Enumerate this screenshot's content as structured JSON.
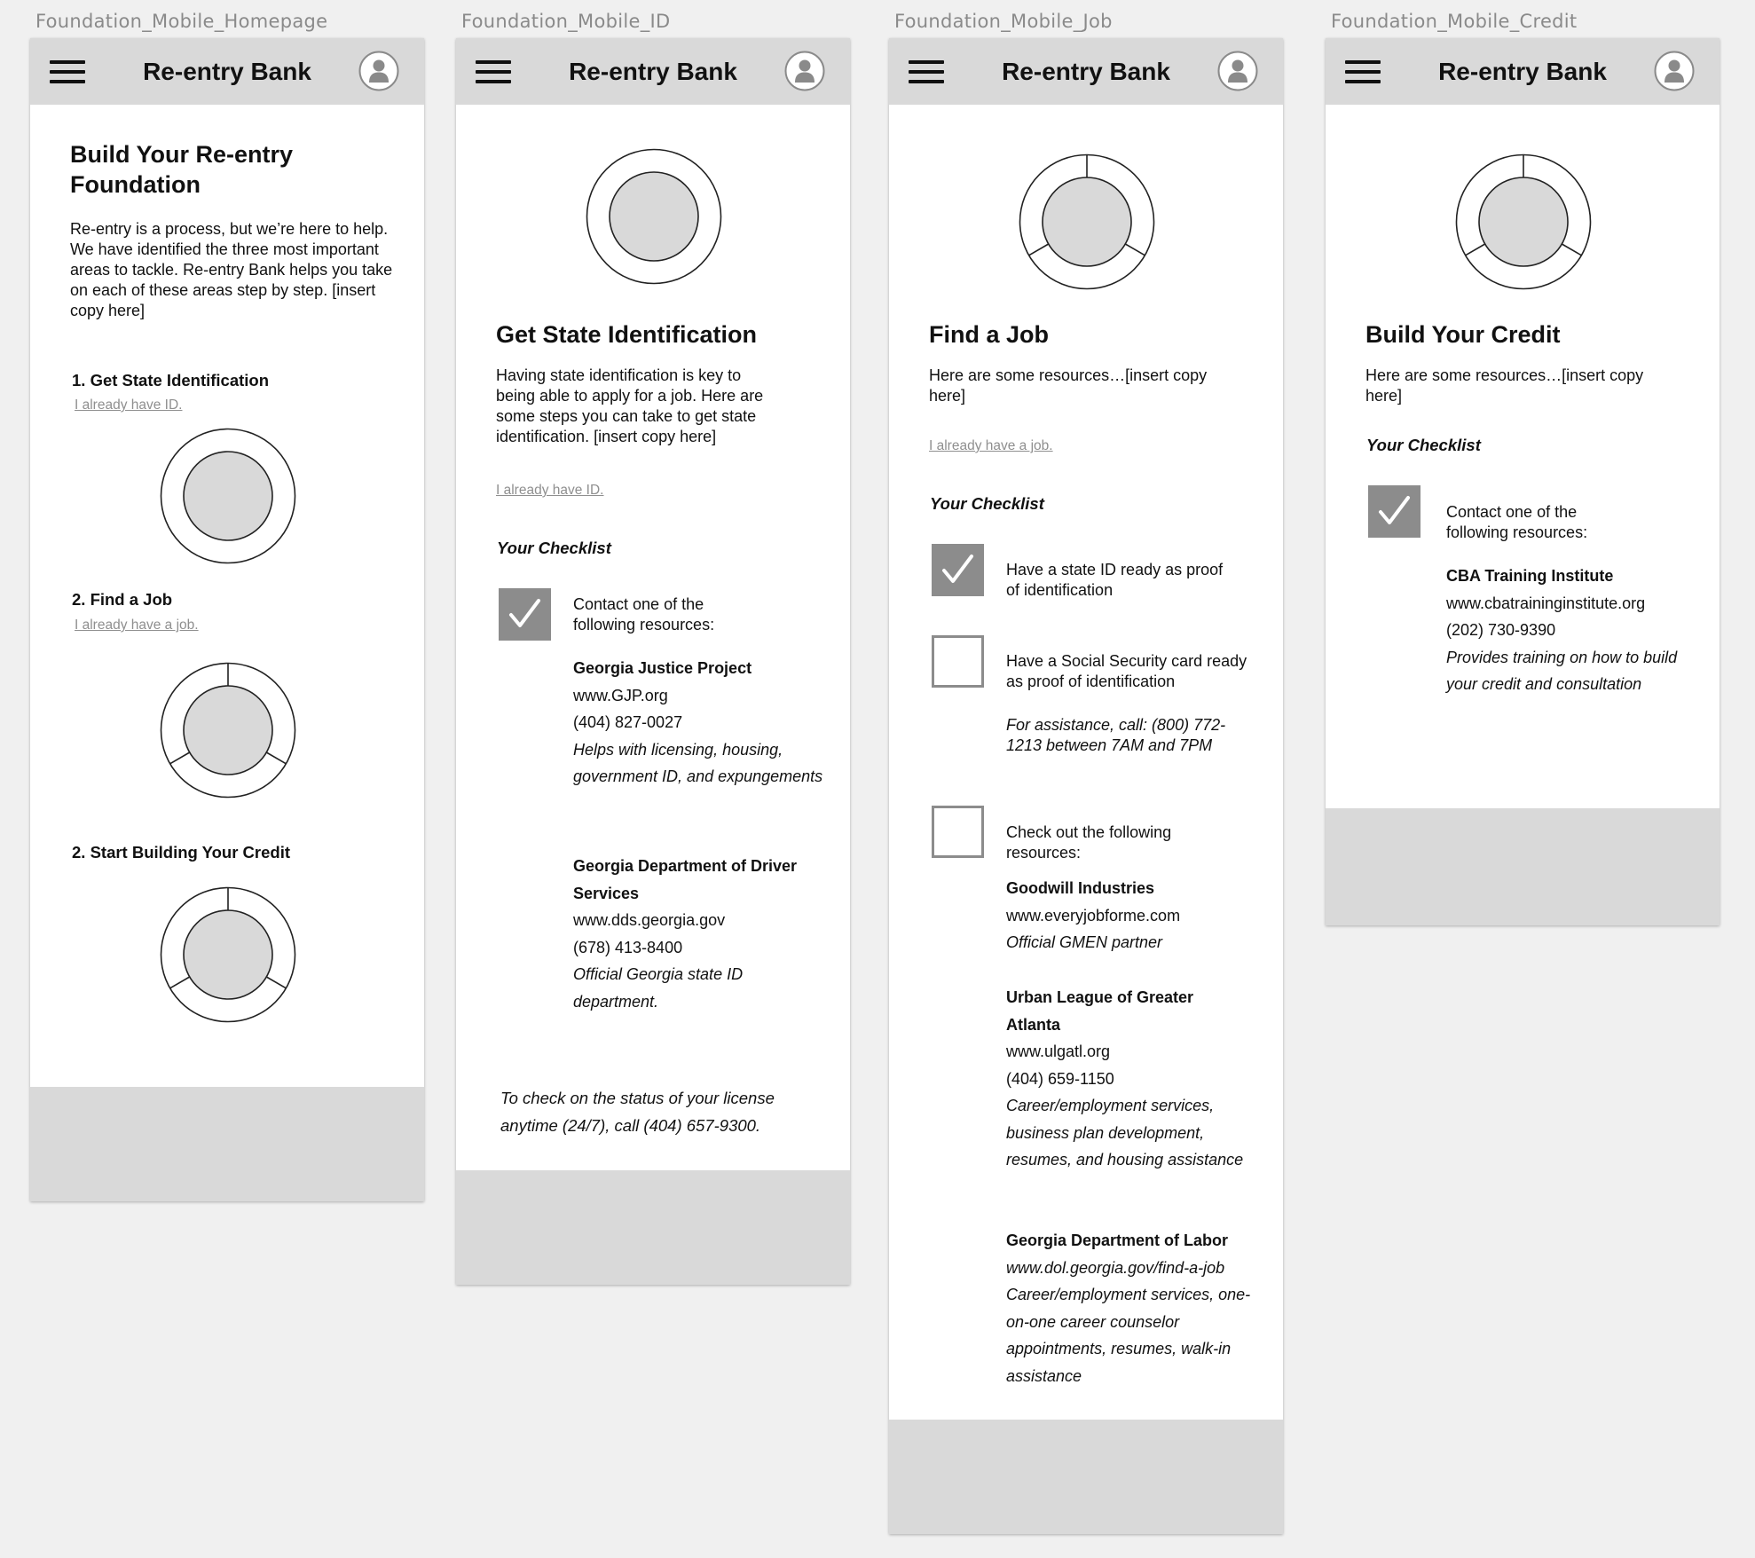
{
  "app": {
    "title": "Re-entry Bank"
  },
  "colors": {
    "header": "#d9d9d9",
    "checkbox": "#8c8c8c",
    "link": "#8f8f8f",
    "progress_fill": "#d9d9d9"
  },
  "icons": {
    "menu": "hamburger-menu-icon",
    "profile": "user-avatar-icon",
    "progress": "progress-ring-icon",
    "check": "checkmark-icon"
  },
  "frames": {
    "homepage": {
      "label": "Foundation_Mobile_Homepage",
      "title": "Build Your Re-entry Foundation",
      "intro": "Re-entry is a process, but we’re here to help. We have identified the three most important areas to tackle. Re-entry Bank helps you take on each of these areas step by step. [insert copy here]",
      "steps": [
        {
          "heading": "1. Get State Identification",
          "link": "I already have ID.",
          "progress_segments": 1
        },
        {
          "heading": "2. Find a Job",
          "link": "I already have a job.",
          "progress_segments": 3
        },
        {
          "heading": "2. Start Building Your Credit",
          "link": "",
          "progress_segments": 3
        }
      ]
    },
    "id": {
      "label": "Foundation_Mobile_ID",
      "title": "Get State Identification",
      "intro": "Having state identification is key to being able to apply for a job. Here are some steps you can take to get state identification. [insert copy here]",
      "link": "I already have ID.",
      "checklist_title": "Your Checklist",
      "items": [
        {
          "text": "Contact one of the following resources:",
          "checked": true
        }
      ],
      "resources": [
        {
          "name": "Georgia Justice Project",
          "url": "www.GJP.org",
          "phone": "(404) 827-0027",
          "desc": "Helps with licensing, housing, government ID, and expungements"
        },
        {
          "name": "Georgia Department of Driver Services",
          "url": "www.dds.georgia.gov",
          "phone": "(678) 413-8400",
          "desc": "Official Georgia state ID department."
        }
      ],
      "note": "To check on the status of your license anytime (24/7), call (404) 657-9300."
    },
    "job": {
      "label": "Foundation_Mobile_Job",
      "title": "Find a Job",
      "intro": "Here are some resources…[insert copy here]",
      "link": "I already have a job.",
      "checklist_title": "Your Checklist",
      "items": [
        {
          "text": "Have a state ID ready as proof of identification",
          "checked": true
        },
        {
          "text": "Have a Social Security card ready as proof of identification",
          "checked": false,
          "note": "For assistance, call: (800) 772-1213 between 7AM and 7PM"
        },
        {
          "text": "Check out the following resources:",
          "checked": false
        }
      ],
      "resources": [
        {
          "name": "Goodwill Industries",
          "url": "www.everyjobforme.com",
          "desc": "Official GMEN partner"
        },
        {
          "name": "Urban League of Greater Atlanta",
          "url": "www.ulgatl.org",
          "phone": "(404) 659-1150",
          "desc": "Career/employment services, business plan development, resumes, and housing assistance"
        },
        {
          "name": "Georgia Department of Labor",
          "url": "www.dol.georgia.gov/find-a-job",
          "desc": "Career/employment services, one-on-one career counselor appointments, resumes, walk-in assistance"
        }
      ]
    },
    "credit": {
      "label": "Foundation_Mobile_Credit",
      "title": "Build Your Credit",
      "intro": "Here are some resources…[insert copy here]",
      "checklist_title": "Your Checklist",
      "items": [
        {
          "text": "Contact one of the following resources:",
          "checked": true
        }
      ],
      "resources": [
        {
          "name": "CBA Training Institute",
          "url": "www.cbatraininginstitute.org",
          "phone": "(202) 730-9390",
          "desc": "Provides training on how to build your credit and consultation"
        }
      ]
    }
  }
}
